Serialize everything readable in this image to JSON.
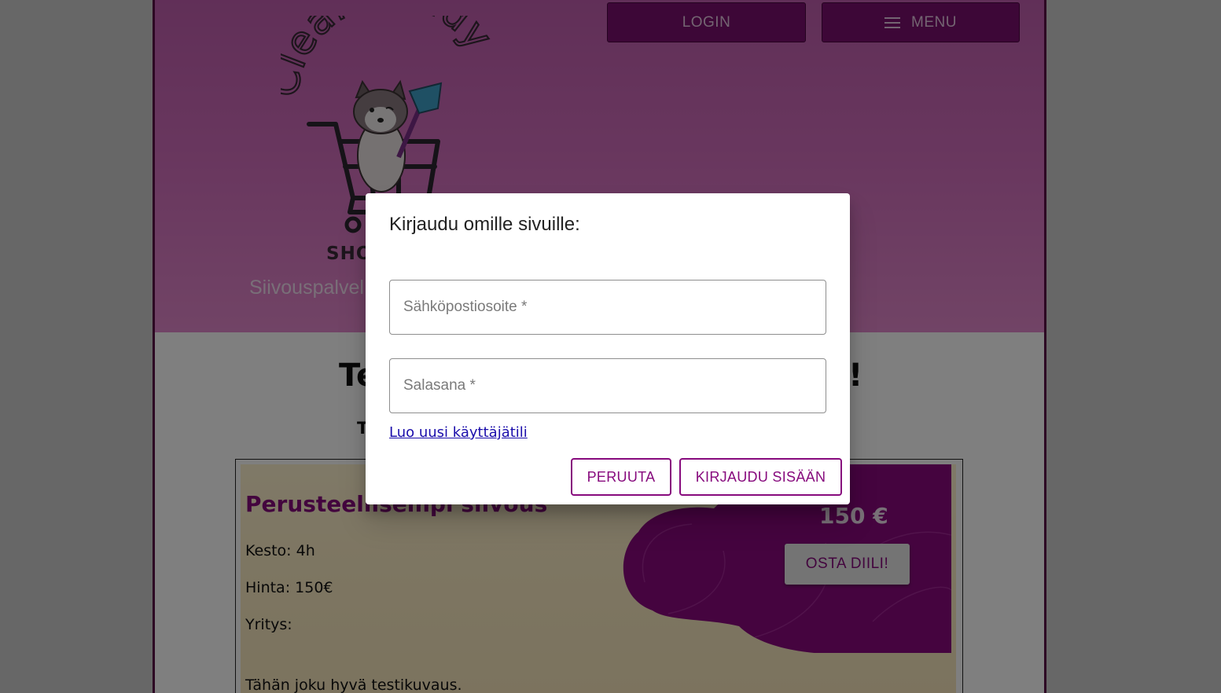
{
  "header": {
    "login_label": "LOGIN",
    "menu_label": "MENU",
    "logo_text": "CleanBuddy",
    "logo_sub": "SHO",
    "tagline": "Siivouspalvel"
  },
  "main": {
    "headline_start": "Te",
    "headline_end": "!",
    "subline": "T",
    "deal": {
      "title": "Perusteellisempi siivous",
      "duration": "Kesto: 4h",
      "price_line": "Hinta: 150€",
      "company": "Yritys:",
      "description": "Tähän joku hyvä testikuvaus.",
      "price_badge": "150 €",
      "buy_label": "OSTA DIILI!"
    }
  },
  "dialog": {
    "title": "Kirjaudu omille sivuille:",
    "email_placeholder": "Sähköpostiosoite *",
    "password_placeholder": "Salasana *",
    "signup_link": "Luo uusi käyttäjätili",
    "cancel_label": "PERUUTA",
    "submit_label": "KIRJAUDU SISÄÄN"
  },
  "colors": {
    "brand_purple": "#870a7d",
    "header_pink": "#d36fbe",
    "nav_button": "#7b0f6e",
    "link_blue": "#1a0dab"
  }
}
